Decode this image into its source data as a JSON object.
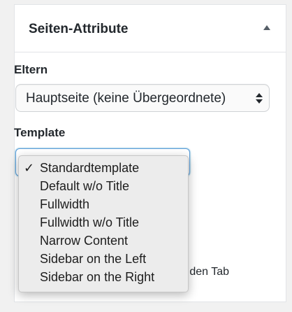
{
  "panel": {
    "title": "Seiten-Attribute",
    "toggle_icon": "triangle-up-icon"
  },
  "parent": {
    "label": "Eltern",
    "selected": "Hauptseite (keine Übergeordnete)"
  },
  "template": {
    "label": "Template",
    "options": [
      {
        "label": "Standardtemplate",
        "selected": true
      },
      {
        "label": "Default w/o Title",
        "selected": false
      },
      {
        "label": "Fullwidth",
        "selected": false
      },
      {
        "label": "Fullwidth w/o Title",
        "selected": false
      },
      {
        "label": "Narrow Content",
        "selected": false
      },
      {
        "label": "Sidebar on the Left",
        "selected": false
      },
      {
        "label": "Sidebar on the Right",
        "selected": false
      }
    ],
    "check_mark": "✓"
  },
  "help_text": {
    "line1": "e den Tab",
    "line2": "."
  },
  "colors": {
    "accent_focus": "#5b9dd9",
    "panel_border": "#e2e4e7",
    "dropdown_bg": "#ececec"
  }
}
